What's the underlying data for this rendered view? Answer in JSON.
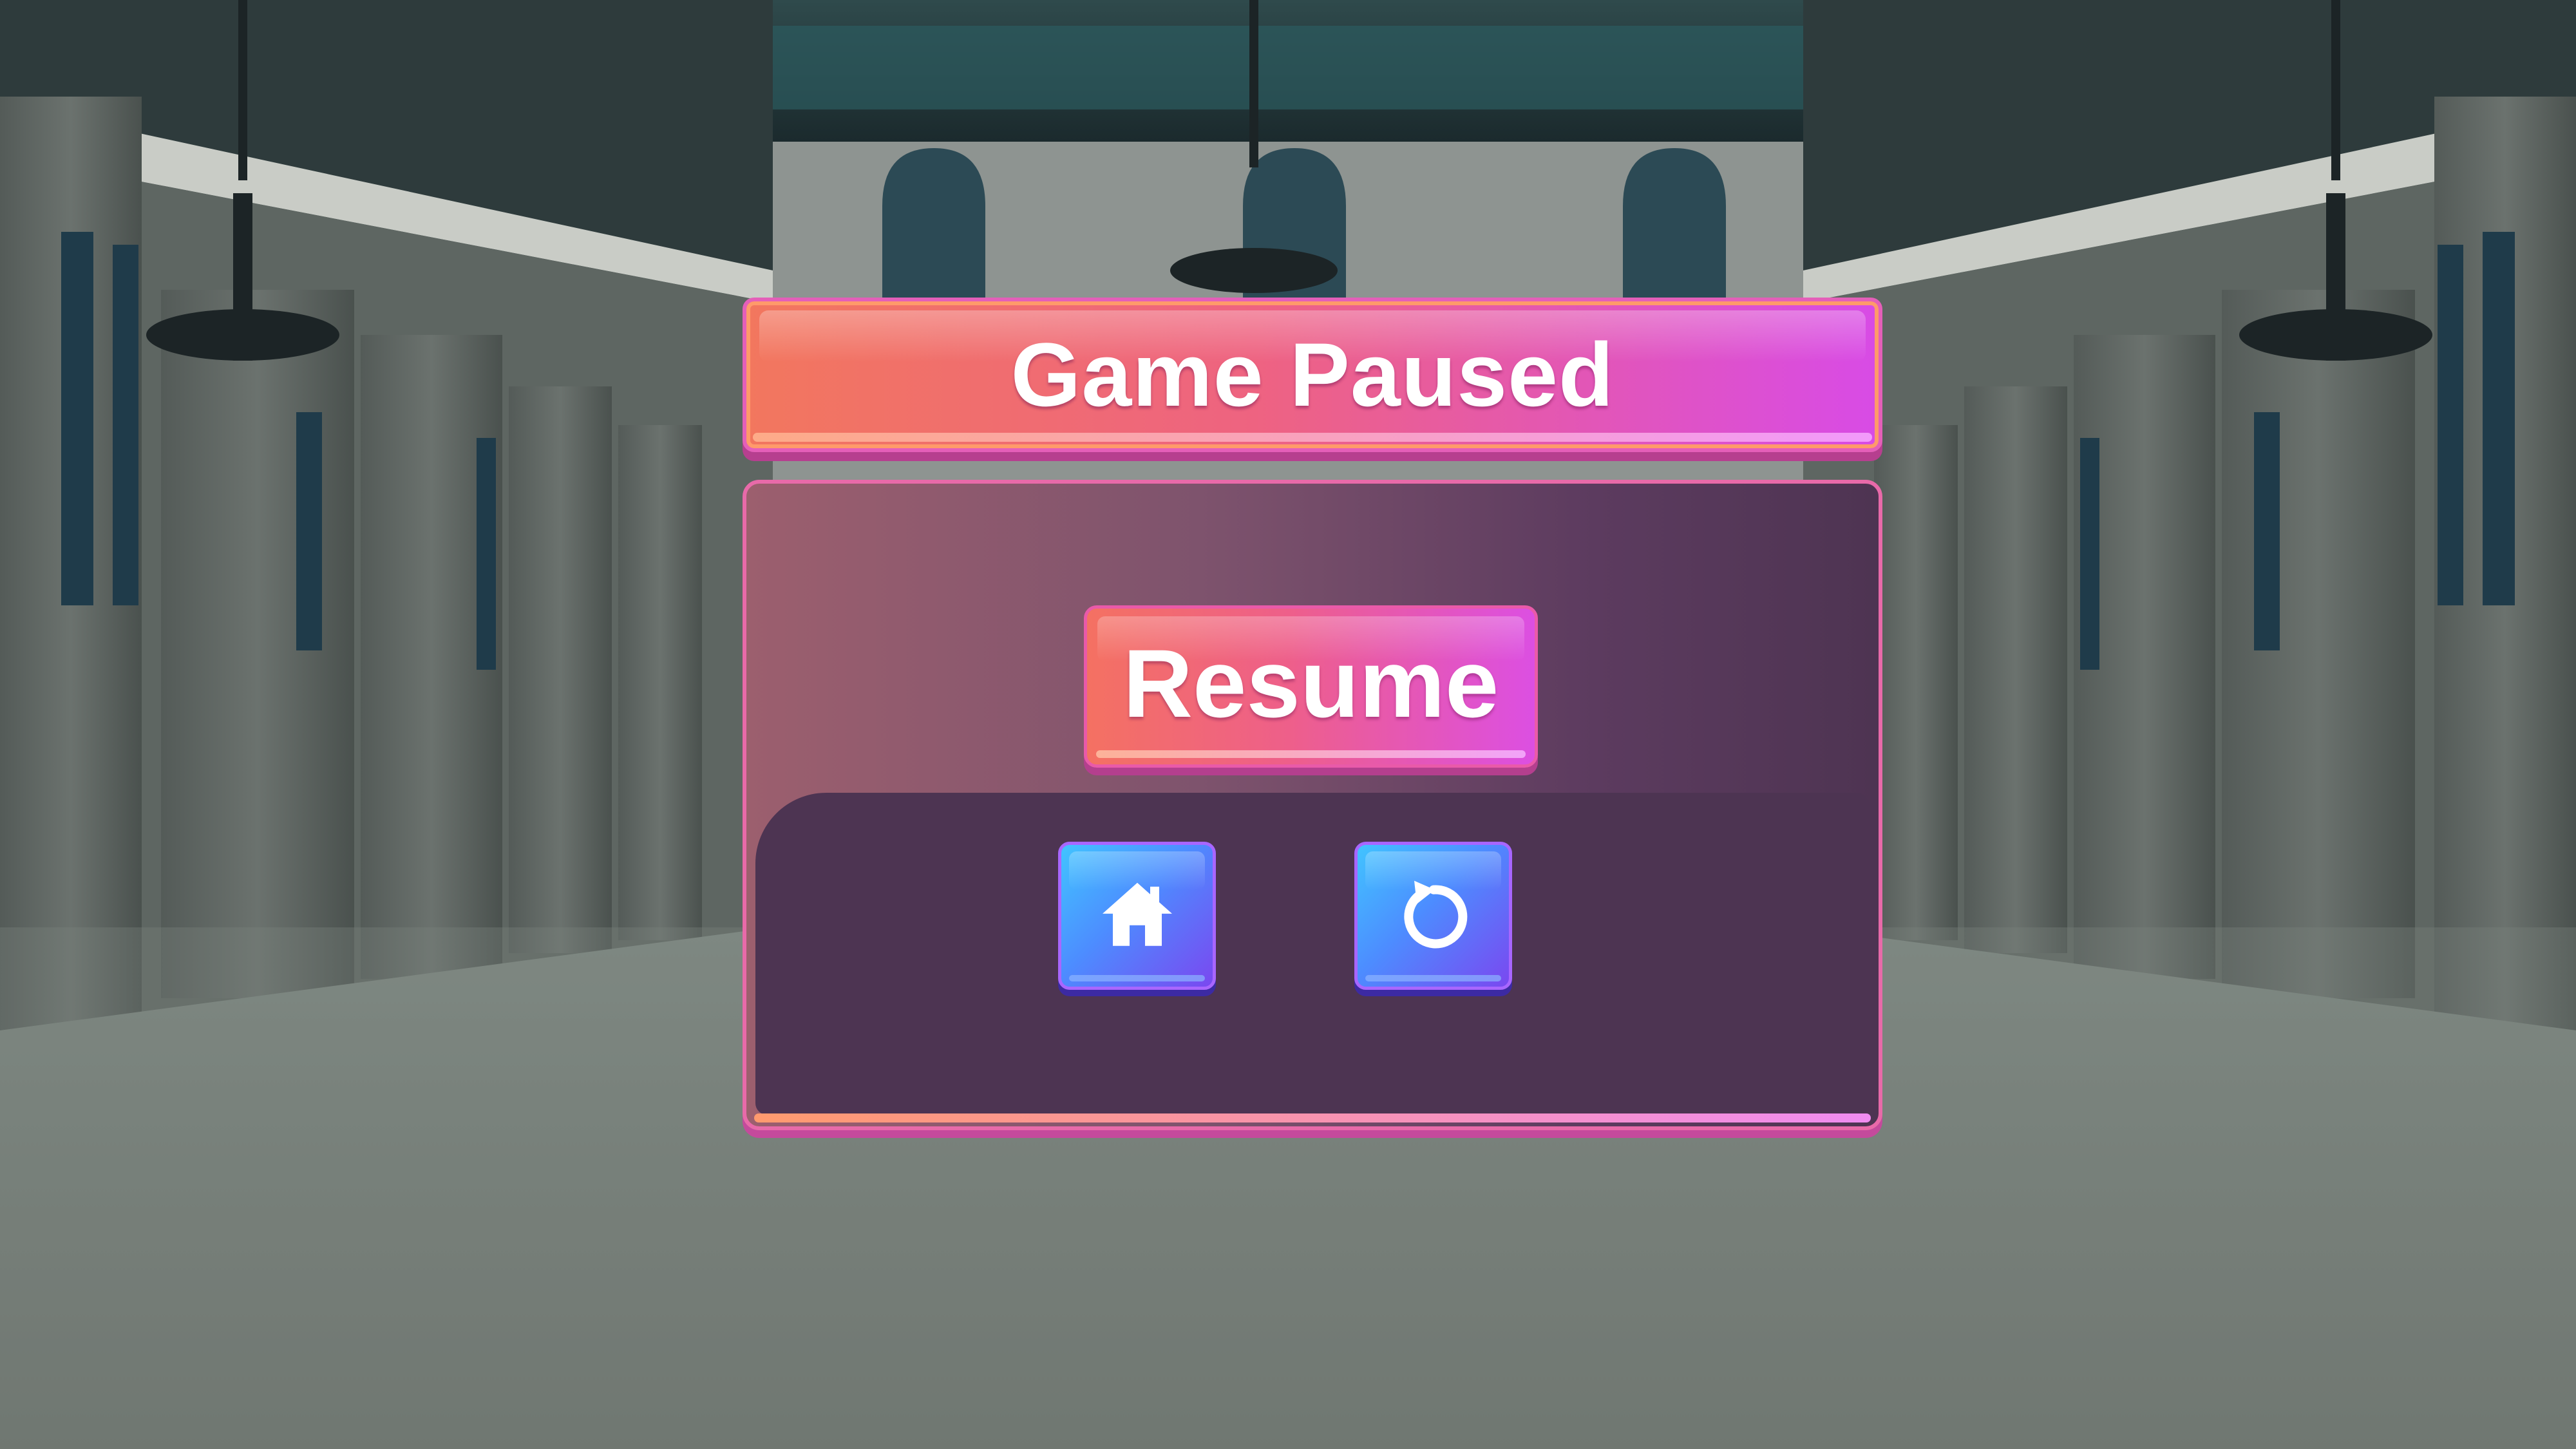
{
  "dialog": {
    "title": "Game Paused",
    "resume_label": "Resume",
    "home_icon": "home-icon",
    "restart_icon": "restart-icon"
  },
  "colors": {
    "accent_orange": "#f2775e",
    "accent_pink": "#d84be6",
    "panel_dark": "#4d3452",
    "icon_blue": "#41c4ff",
    "icon_purple": "#7a48f0"
  }
}
